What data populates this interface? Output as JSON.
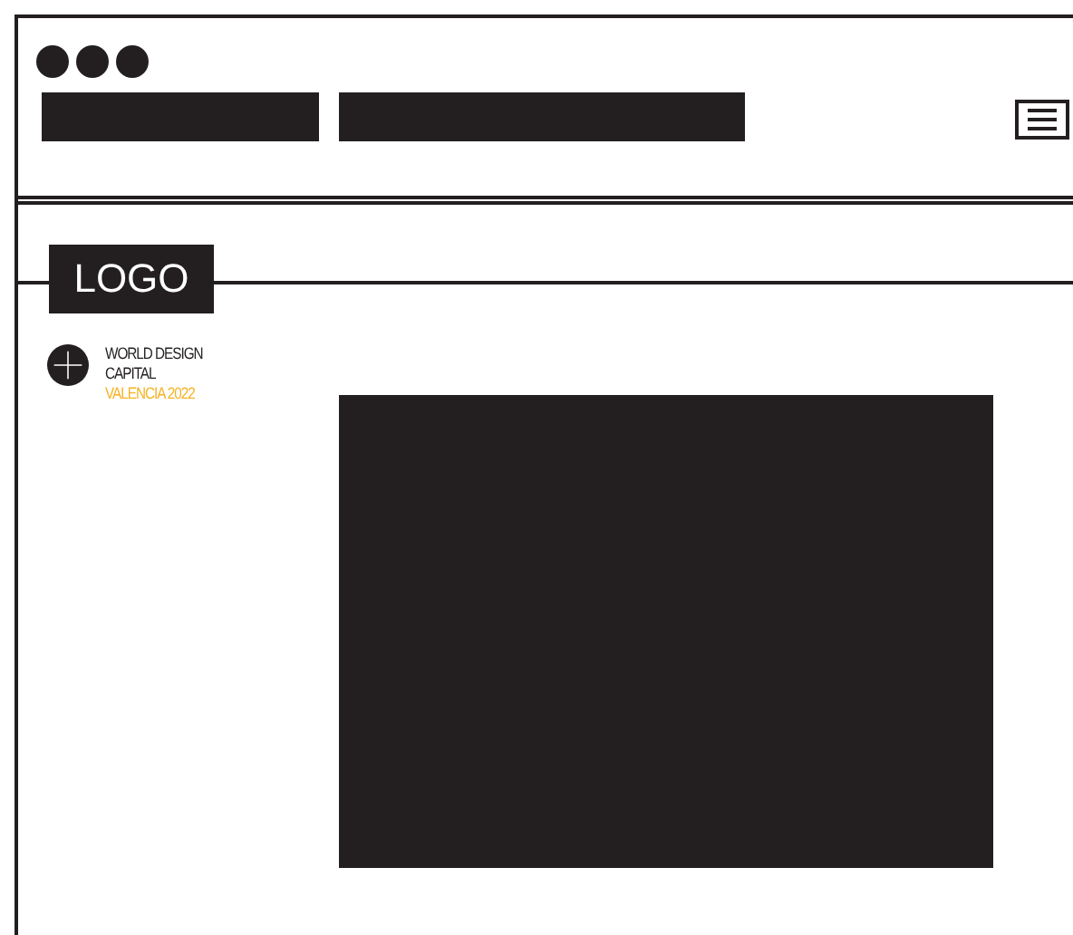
{
  "logo": {
    "text": "LOGO"
  },
  "badge": {
    "lines": [
      "WORLD DESIGN",
      "CAPITAL"
    ],
    "accent_line": "VALENCIA 2022"
  }
}
